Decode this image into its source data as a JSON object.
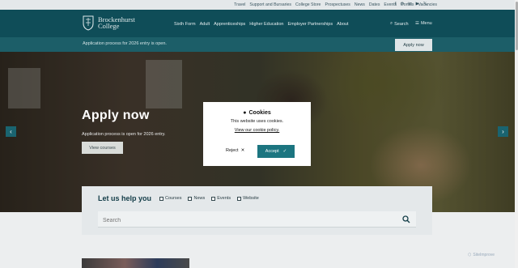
{
  "top_links": [
    "Travel",
    "Support and Bursaries",
    "College Store",
    "Prospectuses",
    "News",
    "Dates",
    "Events",
    "Portals",
    "Vacancies"
  ],
  "social_icons": [
    "facebook-icon",
    "instagram-icon",
    "linkedin-icon",
    "youtube-icon",
    "x-icon"
  ],
  "logo": {
    "line1": "Brockenhurst",
    "line2": "College"
  },
  "nav": [
    "Sixth Form",
    "Adult",
    "Apprenticeships",
    "Higher Education",
    "Employer Partnerships",
    "About"
  ],
  "header": {
    "search_label": "Search",
    "menu_label": "Menu"
  },
  "notice": {
    "text": "Application process for 2026 entry is open.",
    "button": "Apply now"
  },
  "hero": {
    "title": "Apply now",
    "subtitle": "Application process is open for 2026 entry.",
    "button": "View courses"
  },
  "cookie": {
    "title": "Cookies",
    "text": "This website uses cookies.",
    "link": "View our cookie policy.",
    "reject": "Reject",
    "accept": "Accept"
  },
  "help": {
    "title": "Let us help you",
    "options": [
      "Courses",
      "News",
      "Events",
      "Website"
    ],
    "search_placeholder": "Search"
  },
  "watermark": "SiteImprove",
  "colors": {
    "header": "#0f4d58",
    "accent": "#1c7580",
    "notice": "#1c5e68"
  }
}
